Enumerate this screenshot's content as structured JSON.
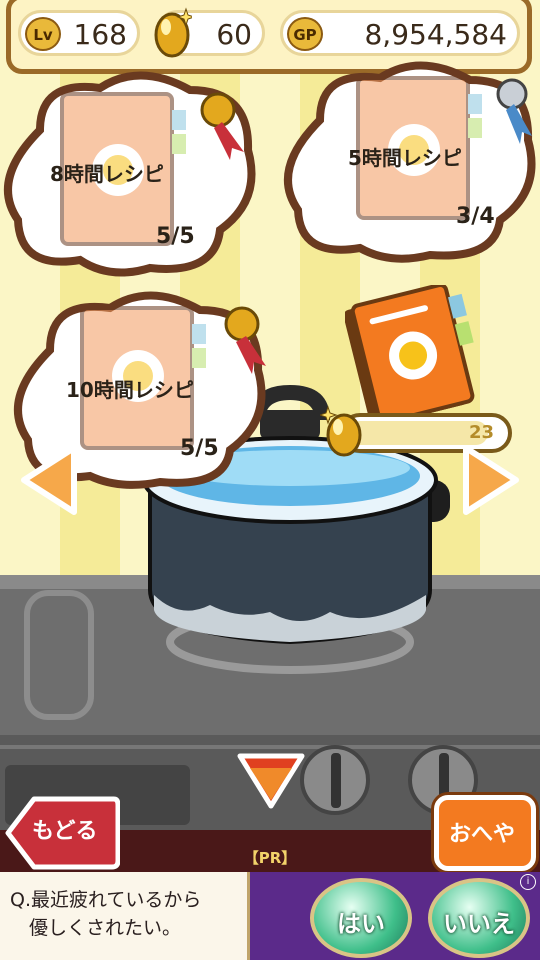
{
  "status": {
    "level_badge": "Lv",
    "level": "168",
    "gold_eggs": "60",
    "gp_badge": "GP",
    "gp": "8,954,584"
  },
  "recipes": [
    {
      "title": "8時間レシピ",
      "count": "5/5",
      "medal": "gold"
    },
    {
      "title": "5時間レシピ",
      "count": "3/4",
      "medal": "silver"
    },
    {
      "title": "10時間レシピ",
      "count": "5/5",
      "medal": "gold"
    }
  ],
  "progress": {
    "value": "23",
    "fraction": 0.9
  },
  "buttons": {
    "back": "もどる",
    "room": "おへや"
  },
  "ad": {
    "pr_label": "【PR】",
    "question": "Q.最近疲れているから\n　優しくされたい。",
    "yes": "はい",
    "no": "いいえ",
    "info": "i"
  },
  "colors": {
    "accent_orange": "#f37a20",
    "frame_brown": "#9a6a28",
    "back_red": "#c8303a"
  }
}
